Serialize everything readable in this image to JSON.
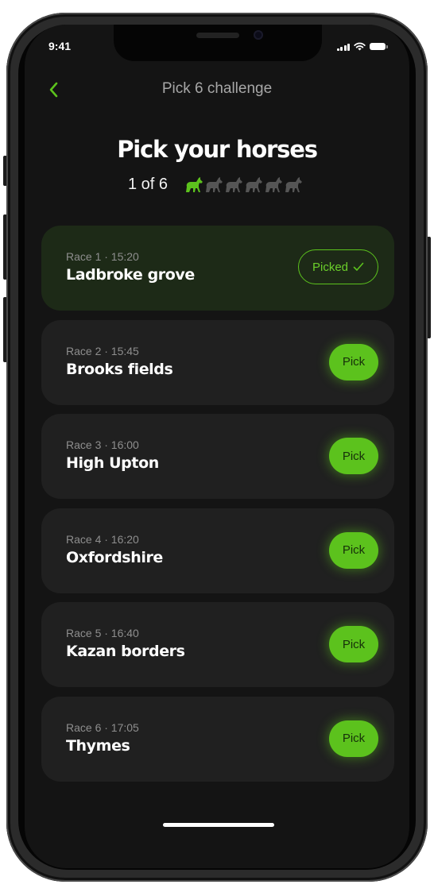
{
  "status_bar": {
    "time": "9:41"
  },
  "nav": {
    "back_icon": "chevron-left-icon",
    "title": "Pick 6 challenge"
  },
  "heading": {
    "title": "Pick your horses",
    "progress": "1 of 6",
    "horse_icon": "horse-icon",
    "horses_picked": 1,
    "horses_total": 6
  },
  "races": [
    {
      "meta": "Race 1 · 15:20",
      "name": "Ladbroke grove",
      "state": "picked",
      "button": "Picked"
    },
    {
      "meta": "Race 2 · 15:45",
      "name": "Brooks fields",
      "state": "open",
      "button": "Pick"
    },
    {
      "meta": "Race 3 · 16:00",
      "name": "High Upton",
      "state": "open",
      "button": "Pick"
    },
    {
      "meta": "Race 4 · 16:20",
      "name": "Oxfordshire",
      "state": "open",
      "button": "Pick"
    },
    {
      "meta": "Race 5 · 16:40",
      "name": "Kazan borders",
      "state": "open",
      "button": "Pick"
    },
    {
      "meta": "Race 6 · 17:05",
      "name": "Thymes",
      "state": "open",
      "button": "Pick"
    }
  ],
  "colors": {
    "accent": "#5cc21d",
    "background": "#141414",
    "card": "#202020",
    "card_picked": "#1d2a17",
    "horse_inactive": "#555555"
  }
}
